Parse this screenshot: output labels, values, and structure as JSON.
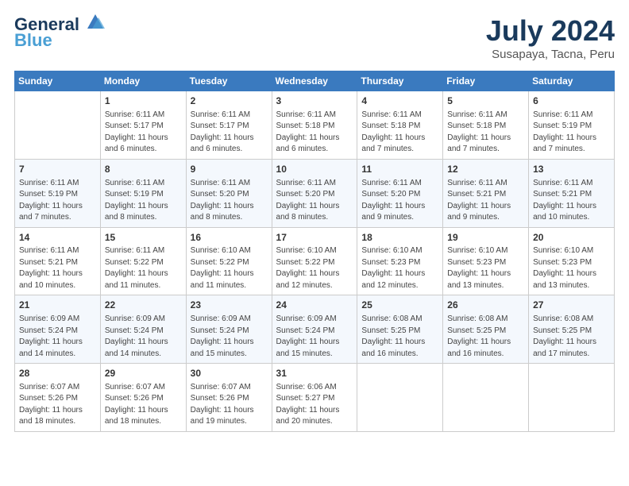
{
  "header": {
    "logo_line1": "General",
    "logo_line2": "Blue",
    "month": "July 2024",
    "location": "Susapaya, Tacna, Peru"
  },
  "days_of_week": [
    "Sunday",
    "Monday",
    "Tuesday",
    "Wednesday",
    "Thursday",
    "Friday",
    "Saturday"
  ],
  "weeks": [
    [
      {
        "day": "",
        "info": ""
      },
      {
        "day": "1",
        "info": "Sunrise: 6:11 AM\nSunset: 5:17 PM\nDaylight: 11 hours\nand 6 minutes."
      },
      {
        "day": "2",
        "info": "Sunrise: 6:11 AM\nSunset: 5:17 PM\nDaylight: 11 hours\nand 6 minutes."
      },
      {
        "day": "3",
        "info": "Sunrise: 6:11 AM\nSunset: 5:18 PM\nDaylight: 11 hours\nand 6 minutes."
      },
      {
        "day": "4",
        "info": "Sunrise: 6:11 AM\nSunset: 5:18 PM\nDaylight: 11 hours\nand 7 minutes."
      },
      {
        "day": "5",
        "info": "Sunrise: 6:11 AM\nSunset: 5:18 PM\nDaylight: 11 hours\nand 7 minutes."
      },
      {
        "day": "6",
        "info": "Sunrise: 6:11 AM\nSunset: 5:19 PM\nDaylight: 11 hours\nand 7 minutes."
      }
    ],
    [
      {
        "day": "7",
        "info": "Sunrise: 6:11 AM\nSunset: 5:19 PM\nDaylight: 11 hours\nand 7 minutes."
      },
      {
        "day": "8",
        "info": "Sunrise: 6:11 AM\nSunset: 5:19 PM\nDaylight: 11 hours\nand 8 minutes."
      },
      {
        "day": "9",
        "info": "Sunrise: 6:11 AM\nSunset: 5:20 PM\nDaylight: 11 hours\nand 8 minutes."
      },
      {
        "day": "10",
        "info": "Sunrise: 6:11 AM\nSunset: 5:20 PM\nDaylight: 11 hours\nand 8 minutes."
      },
      {
        "day": "11",
        "info": "Sunrise: 6:11 AM\nSunset: 5:20 PM\nDaylight: 11 hours\nand 9 minutes."
      },
      {
        "day": "12",
        "info": "Sunrise: 6:11 AM\nSunset: 5:21 PM\nDaylight: 11 hours\nand 9 minutes."
      },
      {
        "day": "13",
        "info": "Sunrise: 6:11 AM\nSunset: 5:21 PM\nDaylight: 11 hours\nand 10 minutes."
      }
    ],
    [
      {
        "day": "14",
        "info": "Sunrise: 6:11 AM\nSunset: 5:21 PM\nDaylight: 11 hours\nand 10 minutes."
      },
      {
        "day": "15",
        "info": "Sunrise: 6:11 AM\nSunset: 5:22 PM\nDaylight: 11 hours\nand 11 minutes."
      },
      {
        "day": "16",
        "info": "Sunrise: 6:10 AM\nSunset: 5:22 PM\nDaylight: 11 hours\nand 11 minutes."
      },
      {
        "day": "17",
        "info": "Sunrise: 6:10 AM\nSunset: 5:22 PM\nDaylight: 11 hours\nand 12 minutes."
      },
      {
        "day": "18",
        "info": "Sunrise: 6:10 AM\nSunset: 5:23 PM\nDaylight: 11 hours\nand 12 minutes."
      },
      {
        "day": "19",
        "info": "Sunrise: 6:10 AM\nSunset: 5:23 PM\nDaylight: 11 hours\nand 13 minutes."
      },
      {
        "day": "20",
        "info": "Sunrise: 6:10 AM\nSunset: 5:23 PM\nDaylight: 11 hours\nand 13 minutes."
      }
    ],
    [
      {
        "day": "21",
        "info": "Sunrise: 6:09 AM\nSunset: 5:24 PM\nDaylight: 11 hours\nand 14 minutes."
      },
      {
        "day": "22",
        "info": "Sunrise: 6:09 AM\nSunset: 5:24 PM\nDaylight: 11 hours\nand 14 minutes."
      },
      {
        "day": "23",
        "info": "Sunrise: 6:09 AM\nSunset: 5:24 PM\nDaylight: 11 hours\nand 15 minutes."
      },
      {
        "day": "24",
        "info": "Sunrise: 6:09 AM\nSunset: 5:24 PM\nDaylight: 11 hours\nand 15 minutes."
      },
      {
        "day": "25",
        "info": "Sunrise: 6:08 AM\nSunset: 5:25 PM\nDaylight: 11 hours\nand 16 minutes."
      },
      {
        "day": "26",
        "info": "Sunrise: 6:08 AM\nSunset: 5:25 PM\nDaylight: 11 hours\nand 16 minutes."
      },
      {
        "day": "27",
        "info": "Sunrise: 6:08 AM\nSunset: 5:25 PM\nDaylight: 11 hours\nand 17 minutes."
      }
    ],
    [
      {
        "day": "28",
        "info": "Sunrise: 6:07 AM\nSunset: 5:26 PM\nDaylight: 11 hours\nand 18 minutes."
      },
      {
        "day": "29",
        "info": "Sunrise: 6:07 AM\nSunset: 5:26 PM\nDaylight: 11 hours\nand 18 minutes."
      },
      {
        "day": "30",
        "info": "Sunrise: 6:07 AM\nSunset: 5:26 PM\nDaylight: 11 hours\nand 19 minutes."
      },
      {
        "day": "31",
        "info": "Sunrise: 6:06 AM\nSunset: 5:27 PM\nDaylight: 11 hours\nand 20 minutes."
      },
      {
        "day": "",
        "info": ""
      },
      {
        "day": "",
        "info": ""
      },
      {
        "day": "",
        "info": ""
      }
    ]
  ]
}
